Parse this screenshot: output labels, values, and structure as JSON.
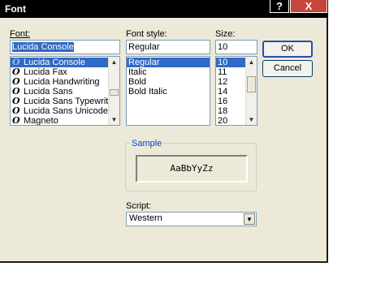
{
  "window": {
    "title": "Font",
    "help_glyph": "?",
    "close_glyph": "X"
  },
  "font": {
    "label": "Font:",
    "value": "Lucida Console",
    "icon_glyph": "O",
    "items": [
      "Lucida Console",
      "Lucida Fax",
      "Lucida Handwriting",
      "Lucida Sans",
      "Lucida Sans Typewrite",
      "Lucida Sans Unicode",
      "Magneto"
    ],
    "selected_index": 0
  },
  "style": {
    "label": "Font style:",
    "value": "Regular",
    "items": [
      "Regular",
      "Italic",
      "Bold",
      "Bold Italic"
    ],
    "selected_index": 0
  },
  "size": {
    "label": "Size:",
    "value": "10",
    "items": [
      "10",
      "11",
      "12",
      "14",
      "16",
      "18",
      "20"
    ],
    "selected_index": 0
  },
  "buttons": {
    "ok": "OK",
    "cancel": "Cancel"
  },
  "sample": {
    "label": "Sample",
    "text": "AaBbYyZz"
  },
  "script": {
    "label": "Script:",
    "value": "Western"
  },
  "colors": {
    "titlebar": "#000000",
    "selection": "#316ac5",
    "dialog_bg": "#ece9d8",
    "close_button": "#c5463a"
  }
}
